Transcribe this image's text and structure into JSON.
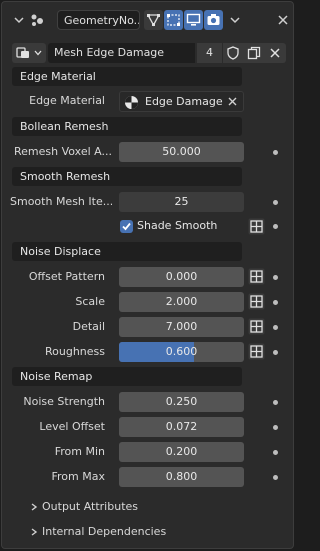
{
  "header": {
    "modifier_name": "GeometryNo..."
  },
  "datablock": {
    "name": "Mesh Edge Damage",
    "users": "4"
  },
  "sections": {
    "edge_material": "Edge Material",
    "boolean_remesh": "Bollean Remesh",
    "smooth_remesh": "Smooth Remesh",
    "noise_displace": "Noise Displace",
    "noise_remap": "Noise Remap"
  },
  "fields": {
    "edge_material": {
      "label": "Edge Material",
      "value": "Edge Damage"
    },
    "remesh_voxel": {
      "label": "Remesh Voxel A...",
      "value": "50.000"
    },
    "smooth_mesh_iter": {
      "label": "Smooth Mesh Ite...",
      "value": "25"
    },
    "shade_smooth": {
      "label": "Shade Smooth",
      "checked": true
    },
    "offset_pattern": {
      "label": "Offset Pattern",
      "value": "0.000"
    },
    "scale": {
      "label": "Scale",
      "value": "2.000"
    },
    "detail": {
      "label": "Detail",
      "value": "7.000"
    },
    "roughness": {
      "label": "Roughness",
      "value": "0.600",
      "fill": 0.6
    },
    "noise_strength": {
      "label": "Noise Strength",
      "value": "0.250"
    },
    "level_offset": {
      "label": "Level Offset",
      "value": "0.072"
    },
    "from_min": {
      "label": "From Min",
      "value": "0.200"
    },
    "from_max": {
      "label": "From Max",
      "value": "0.800"
    }
  },
  "subpanels": {
    "output_attributes": "Output Attributes",
    "internal_dependencies": "Internal Dependencies"
  },
  "colors": {
    "accent": "#4772b3",
    "panel": "#2b2b2b",
    "field": "#545454"
  }
}
